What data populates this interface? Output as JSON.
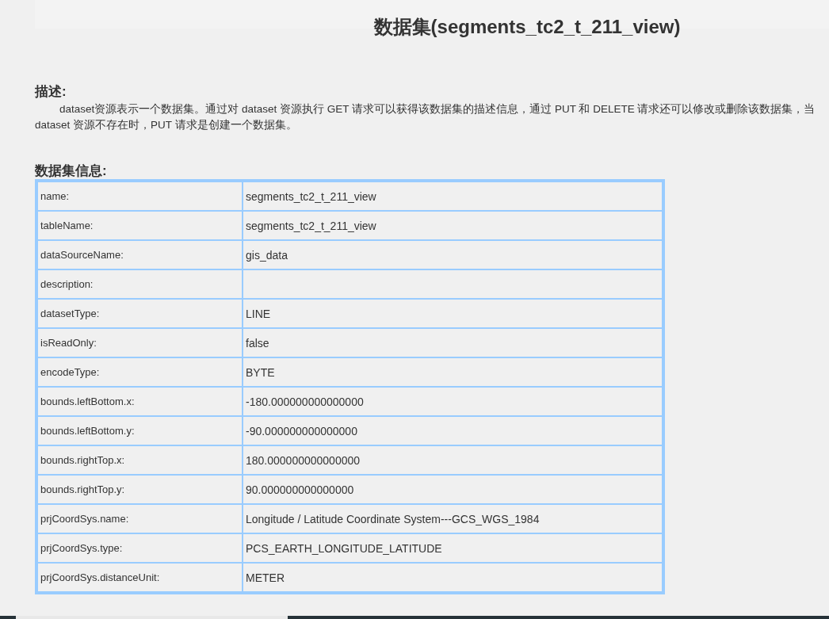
{
  "title": "数据集(segments_tc2_t_211_view)",
  "description": {
    "heading": "描述:",
    "text": "dataset资源表示一个数据集。通过对 dataset 资源执行 GET 请求可以获得该数据集的描述信息，通过 PUT 和 DELETE 请求还可以修改或删除该数据集，当dataset 资源不存在时，PUT 请求是创建一个数据集。"
  },
  "info": {
    "heading": "数据集信息:",
    "rows": [
      {
        "key": "name:",
        "value": "segments_tc2_t_211_view"
      },
      {
        "key": "tableName:",
        "value": "segments_tc2_t_211_view"
      },
      {
        "key": "dataSourceName:",
        "value": "gis_data"
      },
      {
        "key": "description:"
      },
      {
        "key": "datasetType:",
        "value": "LINE"
      },
      {
        "key": "isReadOnly:",
        "value": "false"
      },
      {
        "key": "encodeType:",
        "value": "BYTE"
      },
      {
        "key": "bounds.leftBottom.x:",
        "value": "-180.000000000000000"
      },
      {
        "key": "bounds.leftBottom.y:",
        "value": "-90.000000000000000"
      },
      {
        "key": "bounds.rightTop.x:",
        "value": "180.000000000000000"
      },
      {
        "key": "bounds.rightTop.y:",
        "value": "90.000000000000000"
      },
      {
        "key": "prjCoordSys.name:",
        "value": "Longitude / Latitude Coordinate System---GCS_WGS_1984"
      },
      {
        "key": "prjCoordSys.type:",
        "value": "PCS_EARTH_LONGITUDE_LATITUDE"
      },
      {
        "key": "prjCoordSys.distanceUnit:",
        "value": "METER"
      }
    ]
  }
}
